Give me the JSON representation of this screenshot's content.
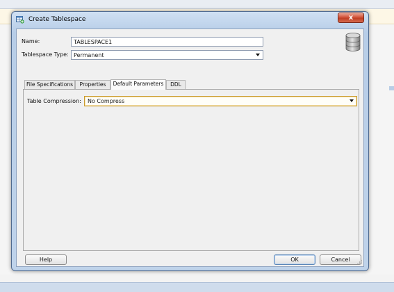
{
  "dialog": {
    "title": "Create Tablespace",
    "close_glyph": "x"
  },
  "form": {
    "name_label": "Name:",
    "name_value": "TABLESPACE1",
    "type_label": "Tablespace Type:",
    "type_value": "Permanent"
  },
  "tabs": [
    {
      "label": "File Specifications",
      "active": false
    },
    {
      "label": "Properties",
      "active": false
    },
    {
      "label": "Default Parameters",
      "active": true
    },
    {
      "label": "DDL",
      "active": false
    }
  ],
  "default_parameters": {
    "compression_label": "Table Compression:",
    "compression_value": "No Compress"
  },
  "buttons": {
    "help": "Help",
    "ok": "OK",
    "cancel": "Cancel"
  },
  "icons": {
    "app": "create-tablespace-icon",
    "database": "database-icon",
    "close": "close-icon",
    "dropdown": "chevron-down-icon",
    "resize": "resize-grip-icon"
  },
  "colors": {
    "titlebar": "#bfd3ea",
    "client_bg": "#f0f0f0",
    "close_button": "#c9482e",
    "focus_border": "#c99a2e"
  }
}
